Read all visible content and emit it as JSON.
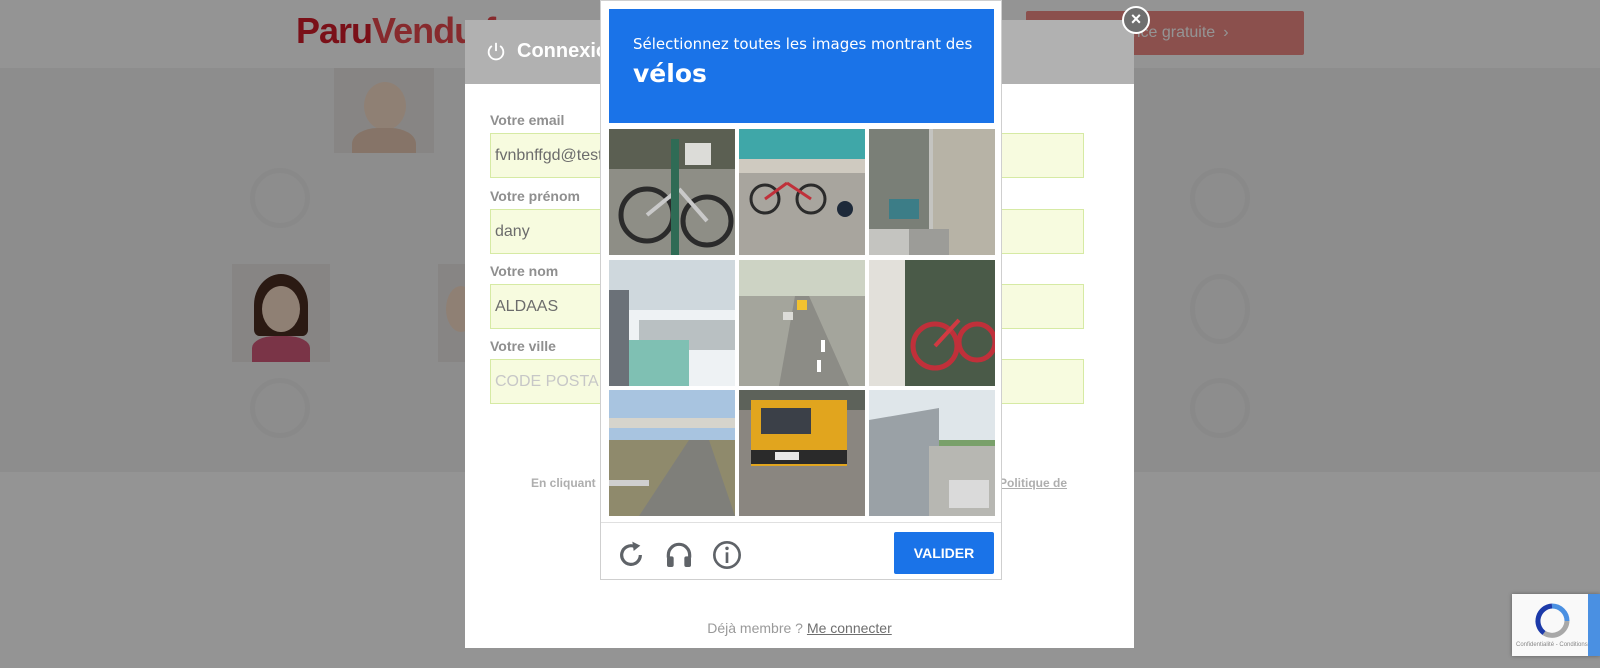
{
  "site": {
    "logo_part1": "Paru",
    "logo_part2": "Vendu.f",
    "cta_label": "annonce gratuite",
    "cta_chevron": "›"
  },
  "modal": {
    "title": "Connexion",
    "fields": [
      {
        "label": "Votre email",
        "value": "fvnbnffgd@test",
        "placeholder": ""
      },
      {
        "label": "Votre prénom",
        "value": "dany",
        "placeholder": ""
      },
      {
        "label": "Votre nom",
        "value": "ALDAAS",
        "placeholder": ""
      },
      {
        "label": "Votre ville",
        "value": "",
        "placeholder": "CODE POSTAL"
      }
    ],
    "terms_text": "En cliquant",
    "terms_link": "Politique de",
    "footer_text": "Déjà membre ?",
    "footer_link": "Me connecter"
  },
  "captcha": {
    "instruction": "Sélectionnez toutes les images montrant des",
    "object": "vélos",
    "tiles": [
      "Bicycle parked by a post with a basket",
      "Red bicycle on a street by a railing",
      "Narrow street with shops",
      "Building corner with blue railing",
      "Road with cars ahead",
      "Red bicycle beside a wall",
      "Highway overpass",
      "Yellow truck on road",
      "House with carport"
    ],
    "verify_label": "VALIDER",
    "icons": [
      "reload-icon",
      "audio-icon",
      "info-icon"
    ]
  },
  "close_label": "×",
  "badge": {
    "legal": "Confidentialité - Conditions"
  },
  "colors": {
    "captcha_blue": "#1a73e8",
    "input_bg": "#f7fbdf",
    "brand_red": "#d21d2a"
  }
}
